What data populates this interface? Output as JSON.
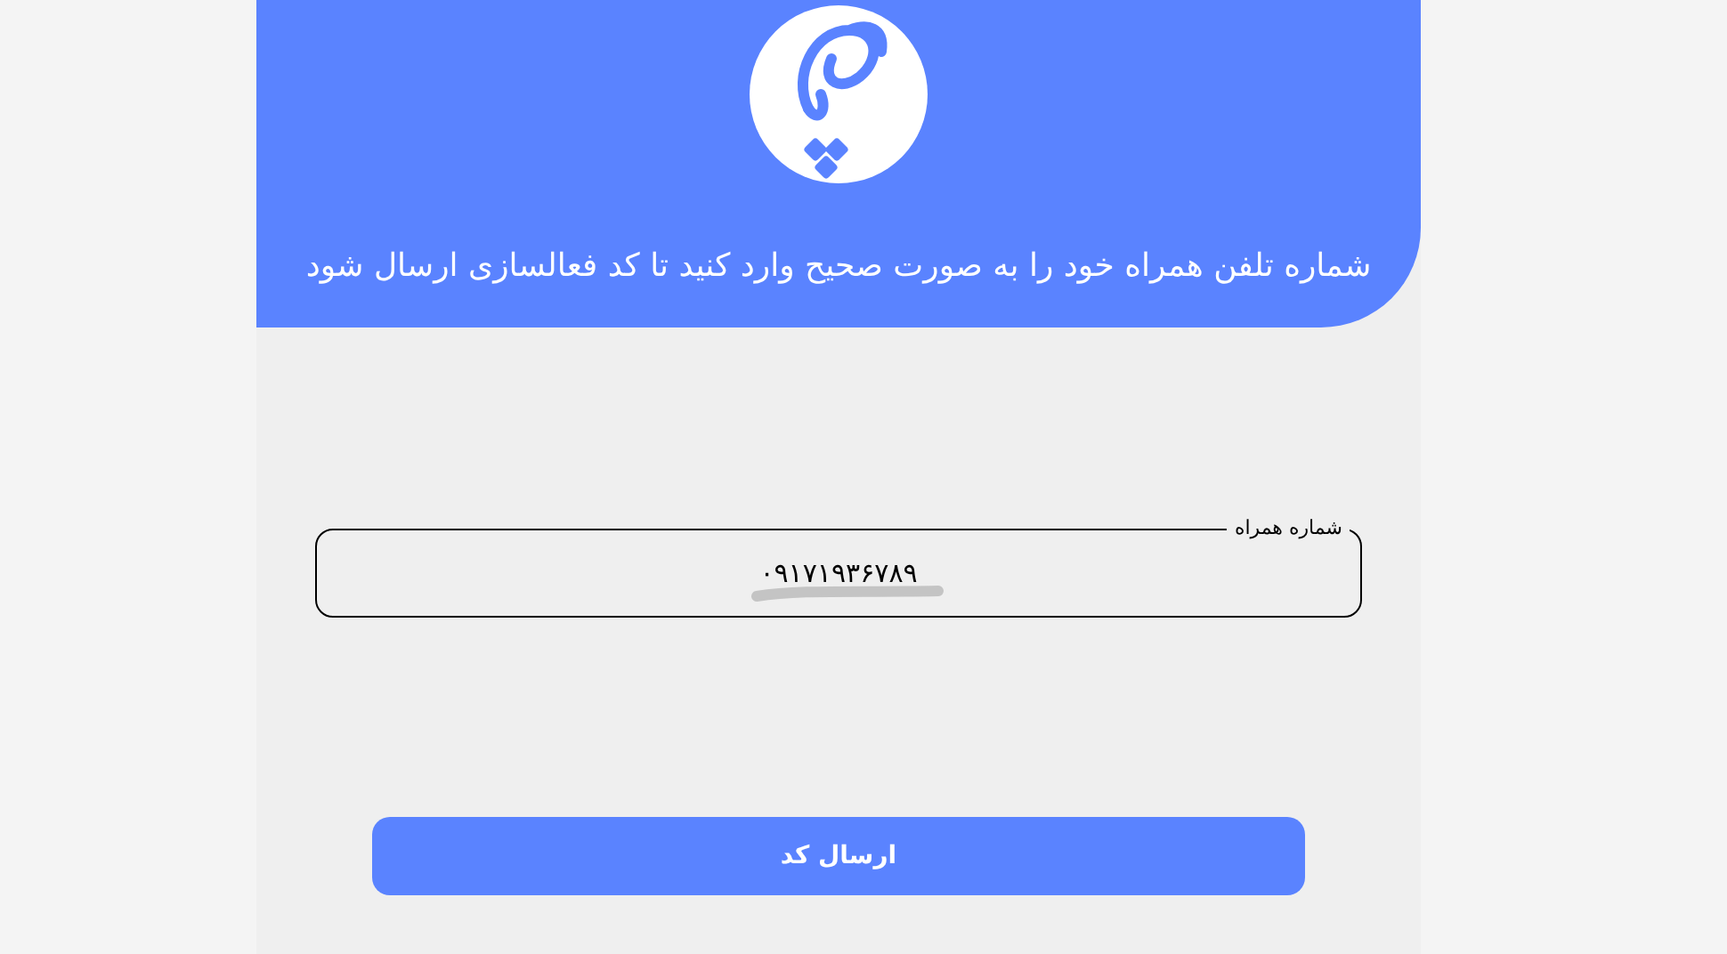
{
  "header": {
    "title": "شماره تلفن همراه خود را به صورت صحیح وارد کنید تا کد فعالسازی ارسال شود"
  },
  "phone_field": {
    "label": "شماره همراه",
    "value": "۰۹۱۷۱۹۳۶۷۸۹"
  },
  "submit_button": {
    "label": "ارسال کد"
  }
}
